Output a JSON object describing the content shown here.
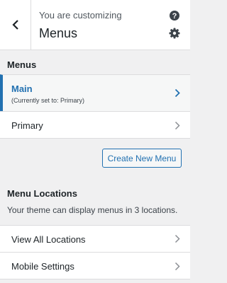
{
  "header": {
    "subtitle": "You are customizing",
    "title": "Menus"
  },
  "icons": {
    "back": "chevron-left-icon",
    "help": "help-icon",
    "settings": "gear-icon",
    "row_arrow": "chevron-right-icon"
  },
  "menus_section": {
    "title": "Menus",
    "items": [
      {
        "label": "Main",
        "sub": "(Currently set to: Primary)"
      },
      {
        "label": "Primary"
      }
    ],
    "create_button": "Create New Menu"
  },
  "locations_section": {
    "title": "Menu Locations",
    "description": "Your theme can display menus in 3 locations.",
    "items": [
      {
        "label": "View All Locations"
      },
      {
        "label": "Mobile Settings"
      }
    ]
  },
  "colors": {
    "accent": "#2271b1",
    "background": "#f0f0f1"
  }
}
